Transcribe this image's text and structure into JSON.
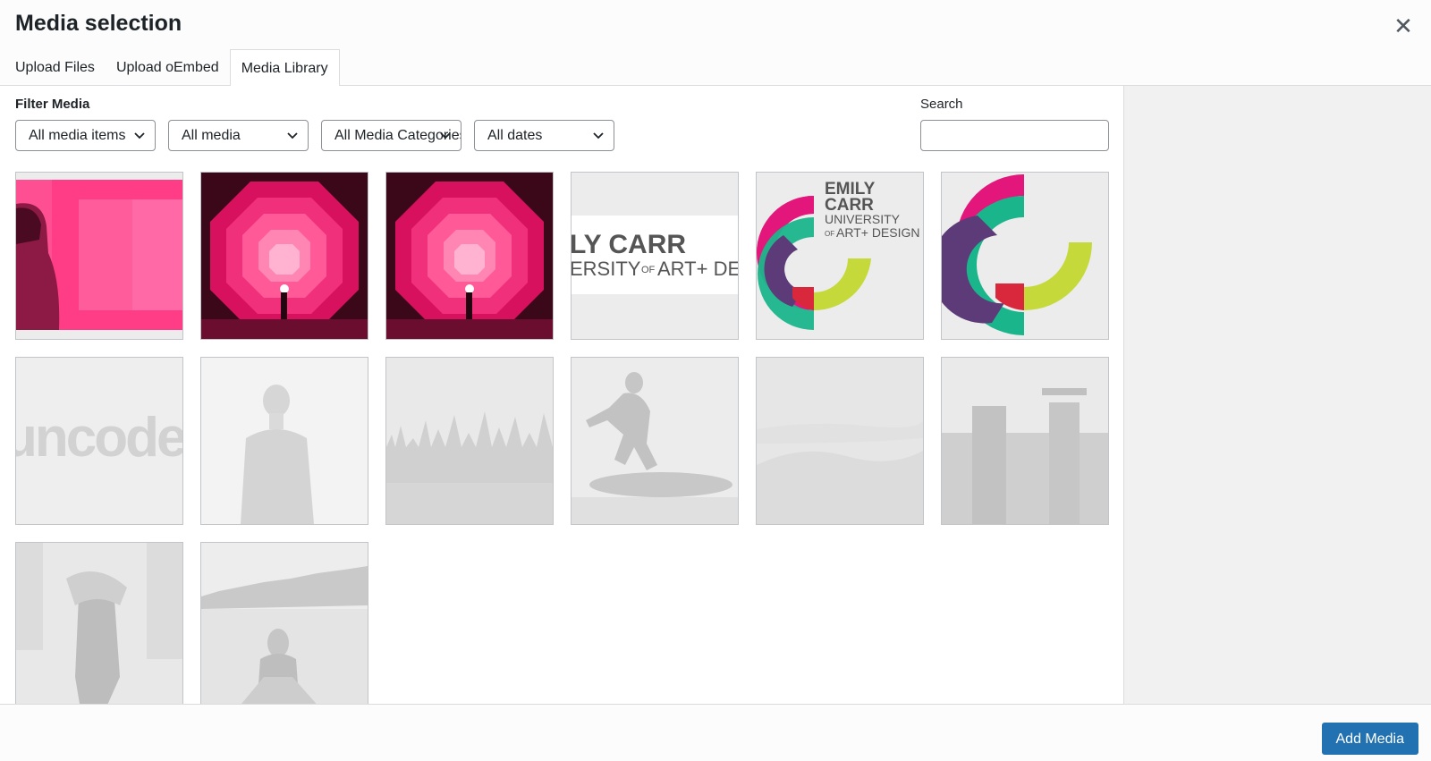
{
  "modal": {
    "title": "Media selection",
    "close_icon": "close-icon"
  },
  "tabs": [
    {
      "label": "Upload Files"
    },
    {
      "label": "Upload oEmbed"
    },
    {
      "label": "Media Library",
      "active": true
    }
  ],
  "filters": {
    "label": "Filter Media",
    "selects": [
      {
        "value": "All media items"
      },
      {
        "value": "All media"
      },
      {
        "value": "All Media Categories"
      },
      {
        "value": "All dates"
      }
    ]
  },
  "search": {
    "label": "Search",
    "value": "",
    "placeholder": ""
  },
  "thumbnails": {
    "logo_a": {
      "line1": "LY CARR",
      "line2": "ERSITY",
      "line2_small": "OF",
      "line2_end": "ART+ DE"
    },
    "logo_b": {
      "line1": "EMILY",
      "line2": "CARR",
      "line3": "UNIVERSITY",
      "line4_small": "OF",
      "line4": "ART+ DESIGN"
    },
    "wordmark": "uncode"
  },
  "footer": {
    "add_button": "Add Media"
  },
  "colors": {
    "accent": "#2271b1",
    "pink": "#ff2d7a",
    "teal": "#1bb58b",
    "lime": "#c5d93a",
    "magenta": "#e3177b",
    "purple": "#5c3b78",
    "red": "#d9283c"
  }
}
